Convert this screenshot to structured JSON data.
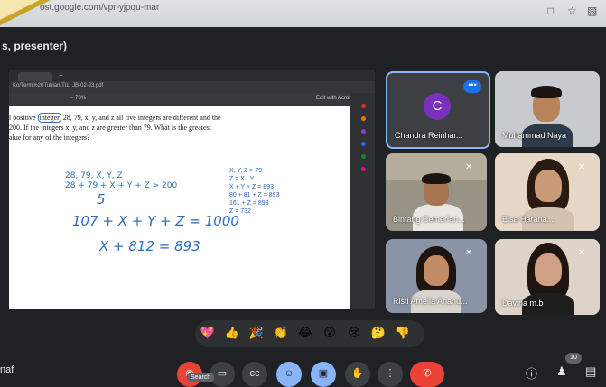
{
  "browser": {
    "url_text": "ost.google.com/vpr-yjpqu-mar"
  },
  "meet": {
    "presenter_label": "s, presenter)",
    "self_name": "naf"
  },
  "shared_screen": {
    "address": "Ko/Term%20Tubian/TIL_JB-02-J3.pdf",
    "zoom": "−  70%  +",
    "edit_label": "Edit with Acrobat",
    "problem_text_1": "l positive",
    "problem_highlight": "integer",
    "problem_text_2": "28, 79, x, y, and z all five integers are different and the",
    "problem_text_3": "200. If the integers x, y, and z are greater than 79. What is the greatest",
    "problem_text_4": "alue for any of the integers?",
    "hw_line1": "28, 79, X, Y, Z",
    "hw_line2": "28 + 79 + X + Y + Z > 200",
    "hw_line3": "5",
    "hw_line4": "107 + X + Y + Z = 1000",
    "hw_line5": "X + 812 = 893",
    "typed_lines": [
      "X, Y, Z > 79",
      "Z > X , Y",
      "X + Y + Z = 893",
      "80 + 81 + Z = 893",
      "161 + Z = 893",
      "Z = 732"
    ]
  },
  "participants": [
    {
      "name": "Chandra Reinhar...",
      "initial": "C",
      "avatar_color": "#7b2fbe",
      "active": true
    },
    {
      "name": "Muhammad Naya"
    },
    {
      "name": "Bintang Cemerlan..."
    },
    {
      "name": "Elsa Harana..."
    },
    {
      "name": "Risti Amelia Ananu..."
    },
    {
      "name": "Davina m.b"
    }
  ],
  "reactions": {
    "icons": [
      "sparkling-heart-icon",
      "thumbs-up-icon",
      "party-popper-icon",
      "clapping-hands-icon",
      "laughing-face-icon",
      "surprised-face-icon",
      "crying-face-icon",
      "thinking-face-icon",
      "thumbs-down-icon"
    ],
    "glyphs": [
      "💖",
      "👍",
      "🎉",
      "👏",
      "😂",
      "😮",
      "😢",
      "🤔",
      "👎"
    ]
  },
  "controls": {
    "tooltip": "Search",
    "participant_count": "10",
    "end_call_color": "#ea4335",
    "accent_blue": "#8ab4f8"
  }
}
